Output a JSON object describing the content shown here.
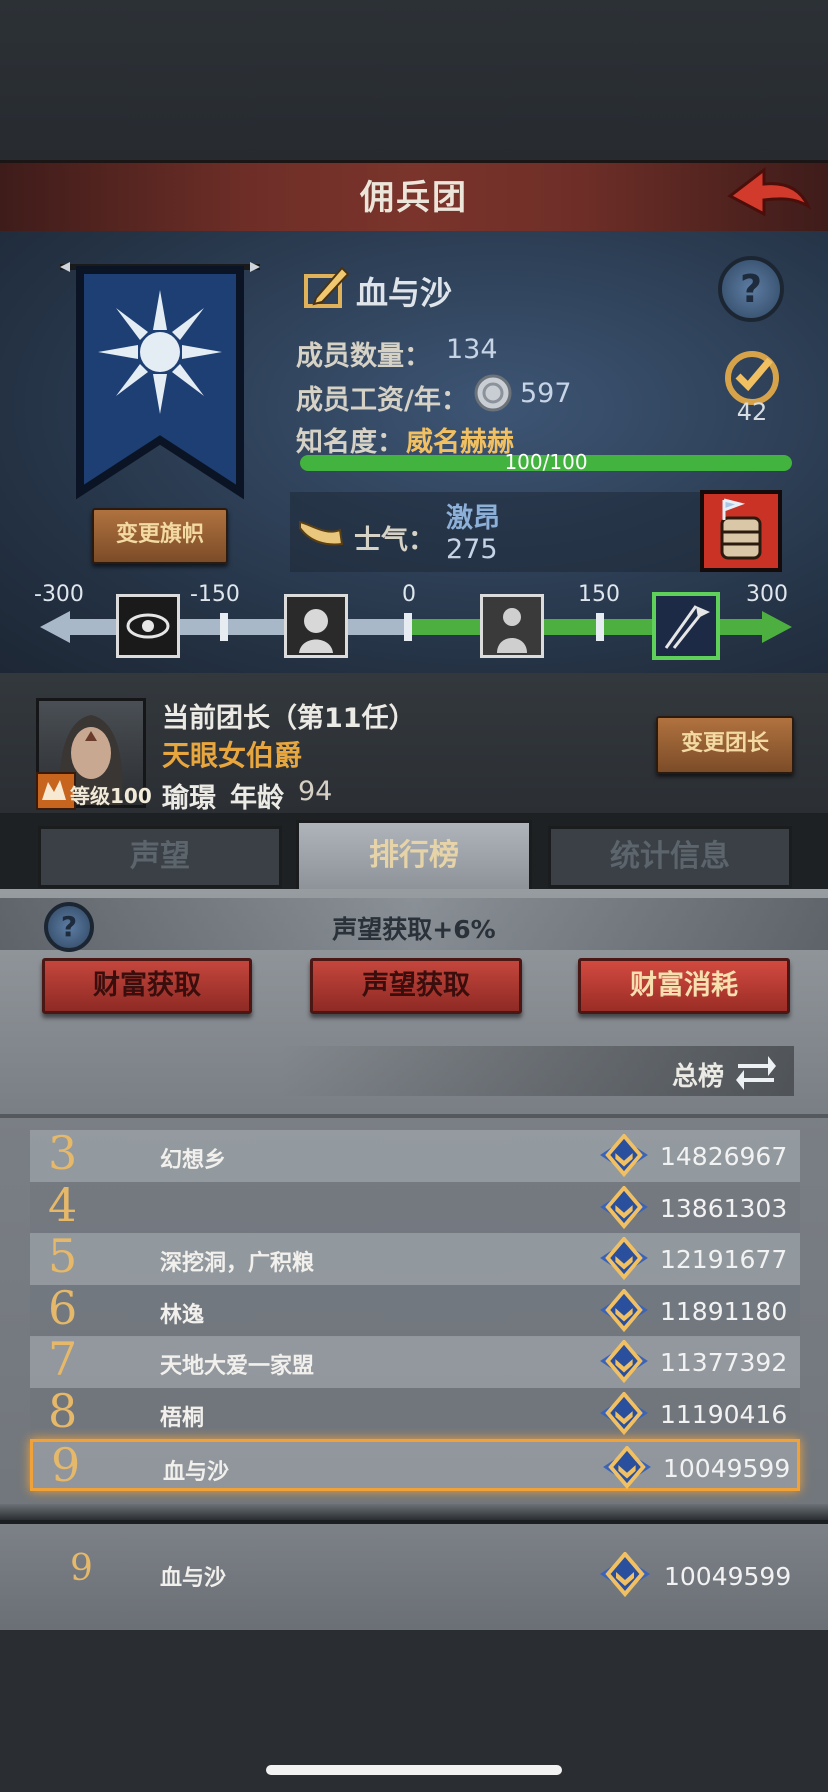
{
  "header": {
    "title": "佣兵团"
  },
  "guild": {
    "name": "血与沙",
    "banner_button": "变更旗帜",
    "members_label": "成员数量：",
    "members_value": "134",
    "wage_label": "成员工资/年：",
    "wage_value": "597",
    "fame_label": "知名度：",
    "fame_value": "威名赫赫",
    "fame_progress_text": "100/100",
    "fame_progress_ratio": 1.0,
    "badge_count": "42",
    "morale_label": "士气：",
    "morale_state": "激昂",
    "morale_value": "275"
  },
  "morale_scale": {
    "ticks": [
      "-300",
      "-150",
      "0",
      "150",
      "300"
    ]
  },
  "leader": {
    "title": "当前团长（第11任）",
    "name_title": "天眼女伯爵",
    "level_label": "等级100",
    "name": "瑜璟",
    "age_label": "年龄",
    "age_value": "94",
    "change_button": "变更团长"
  },
  "tabs": [
    {
      "label": "声望"
    },
    {
      "label": "排行榜"
    },
    {
      "label": "统计信息"
    }
  ],
  "ranking": {
    "bonus_text": "声望获取+6%",
    "buttons": [
      {
        "label": "财富获取"
      },
      {
        "label": "声望获取"
      },
      {
        "label": "财富消耗"
      }
    ],
    "scope_label": "总榜",
    "rows": [
      {
        "rank": "3",
        "name": "幻想乡",
        "score": "14826967"
      },
      {
        "rank": "4",
        "name": "",
        "score": "13861303"
      },
      {
        "rank": "5",
        "name": "深挖洞，广积粮",
        "score": "12191677"
      },
      {
        "rank": "6",
        "name": "林逸",
        "score": "11891180"
      },
      {
        "rank": "7",
        "name": "天地大爱一家盟",
        "score": "11377392"
      },
      {
        "rank": "8",
        "name": "梧桐",
        "score": "11190416"
      },
      {
        "rank": "9",
        "name": "血与沙",
        "score": "10049599"
      }
    ],
    "self": {
      "rank": "9",
      "name": "血与沙",
      "score": "10049599"
    }
  },
  "colors": {
    "accent": "#f1c062",
    "title_red": "#7a342b",
    "morale_green": "#4caf3f",
    "highlight": "#f0a23a"
  }
}
